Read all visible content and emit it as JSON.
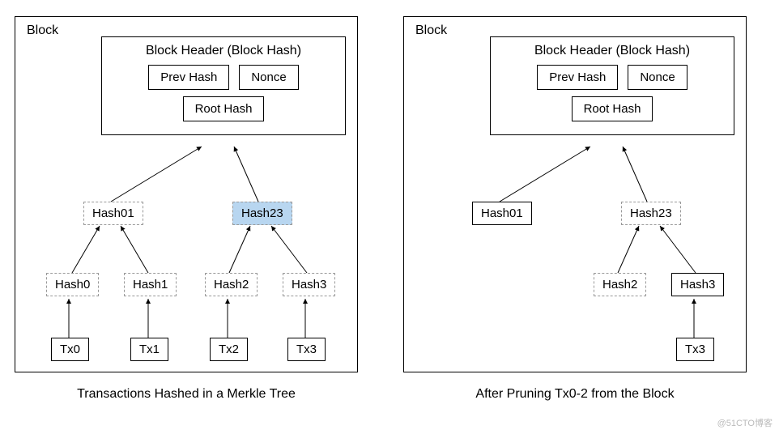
{
  "watermark": "@51CTO博客",
  "left": {
    "block_label": "Block",
    "header_title": "Block Header (Block Hash)",
    "prev_hash": "Prev Hash",
    "nonce": "Nonce",
    "root_hash": "Root Hash",
    "hash01": "Hash01",
    "hash23": "Hash23",
    "h0": "Hash0",
    "h1": "Hash1",
    "h2": "Hash2",
    "h3": "Hash3",
    "tx0": "Tx0",
    "tx1": "Tx1",
    "tx2": "Tx2",
    "tx3": "Tx3",
    "caption": "Transactions Hashed in a Merkle Tree"
  },
  "right": {
    "block_label": "Block",
    "header_title": "Block Header (Block Hash)",
    "prev_hash": "Prev Hash",
    "nonce": "Nonce",
    "root_hash": "Root Hash",
    "hash01": "Hash01",
    "hash23": "Hash23",
    "h2": "Hash2",
    "h3": "Hash3",
    "tx3": "Tx3",
    "caption": "After Pruning Tx0-2 from the Block"
  }
}
